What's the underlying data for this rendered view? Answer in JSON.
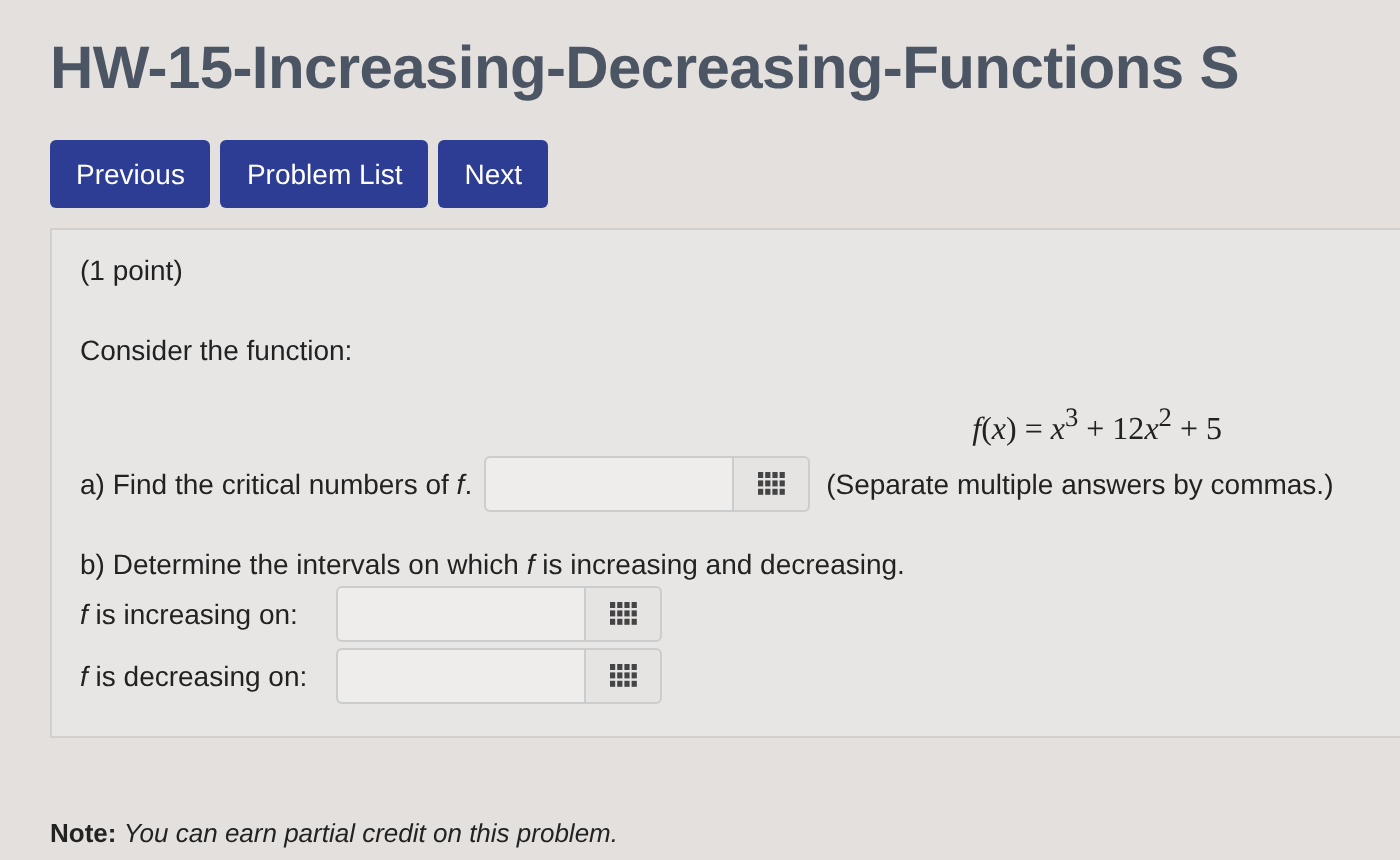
{
  "page_title": "HW-15-Increasing-Decreasing-Functions S",
  "nav_buttons": [
    "Previous",
    "Problem List",
    "Next"
  ],
  "problem": {
    "points": "(1 point)",
    "intro": "Consider the function:",
    "formula_parts": [
      "*f*(*x*) = *x*$^{3}$ + 12",
      "*x*$^{2}$ + 5"
    ],
    "part_a": {
      "prompt": "a) Find the critical numbers of *f*.",
      "hint": "(Separate multiple answers by commas.)"
    },
    "part_b": {
      "prompt": "b) Determine the intervals on which *f* is increasing and decreasing.",
      "fields": [
        {
          "label": "*f* is increasing on:"
        },
        {
          "label": "*f* is decreasing on:"
        }
      ]
    }
  },
  "note": {
    "label": "Note:",
    "text": "You can earn partial credit on this problem."
  }
}
